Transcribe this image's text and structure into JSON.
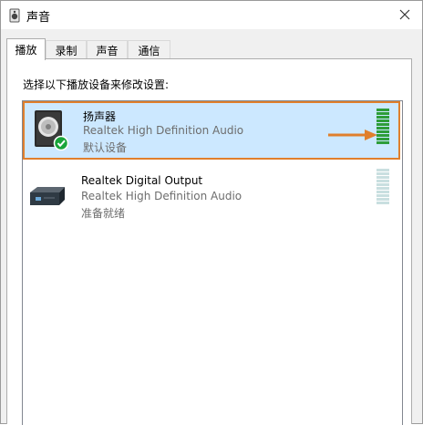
{
  "window": {
    "title": "声音"
  },
  "tabs": [
    {
      "label": "播放",
      "active": true
    },
    {
      "label": "录制",
      "active": false
    },
    {
      "label": "声音",
      "active": false
    },
    {
      "label": "通信",
      "active": false
    }
  ],
  "instruction": "选择以下播放设备来修改设置:",
  "devices": [
    {
      "name": "扬声器",
      "driver": "Realtek High Definition Audio",
      "status": "默认设备",
      "icon": "speaker-icon",
      "is_default": true,
      "selected": true,
      "level": 1.0
    },
    {
      "name": "Realtek Digital Output",
      "driver": "Realtek High Definition Audio",
      "status": "准备就绪",
      "icon": "digital-output-icon",
      "is_default": false,
      "selected": false,
      "level": 0.0
    }
  ],
  "colors": {
    "highlight": "#e07f2c",
    "selection": "#cce8ff",
    "meter_active": "#2e9d3a",
    "meter_idle": "#c9dfe0",
    "check": "#19a53a"
  }
}
